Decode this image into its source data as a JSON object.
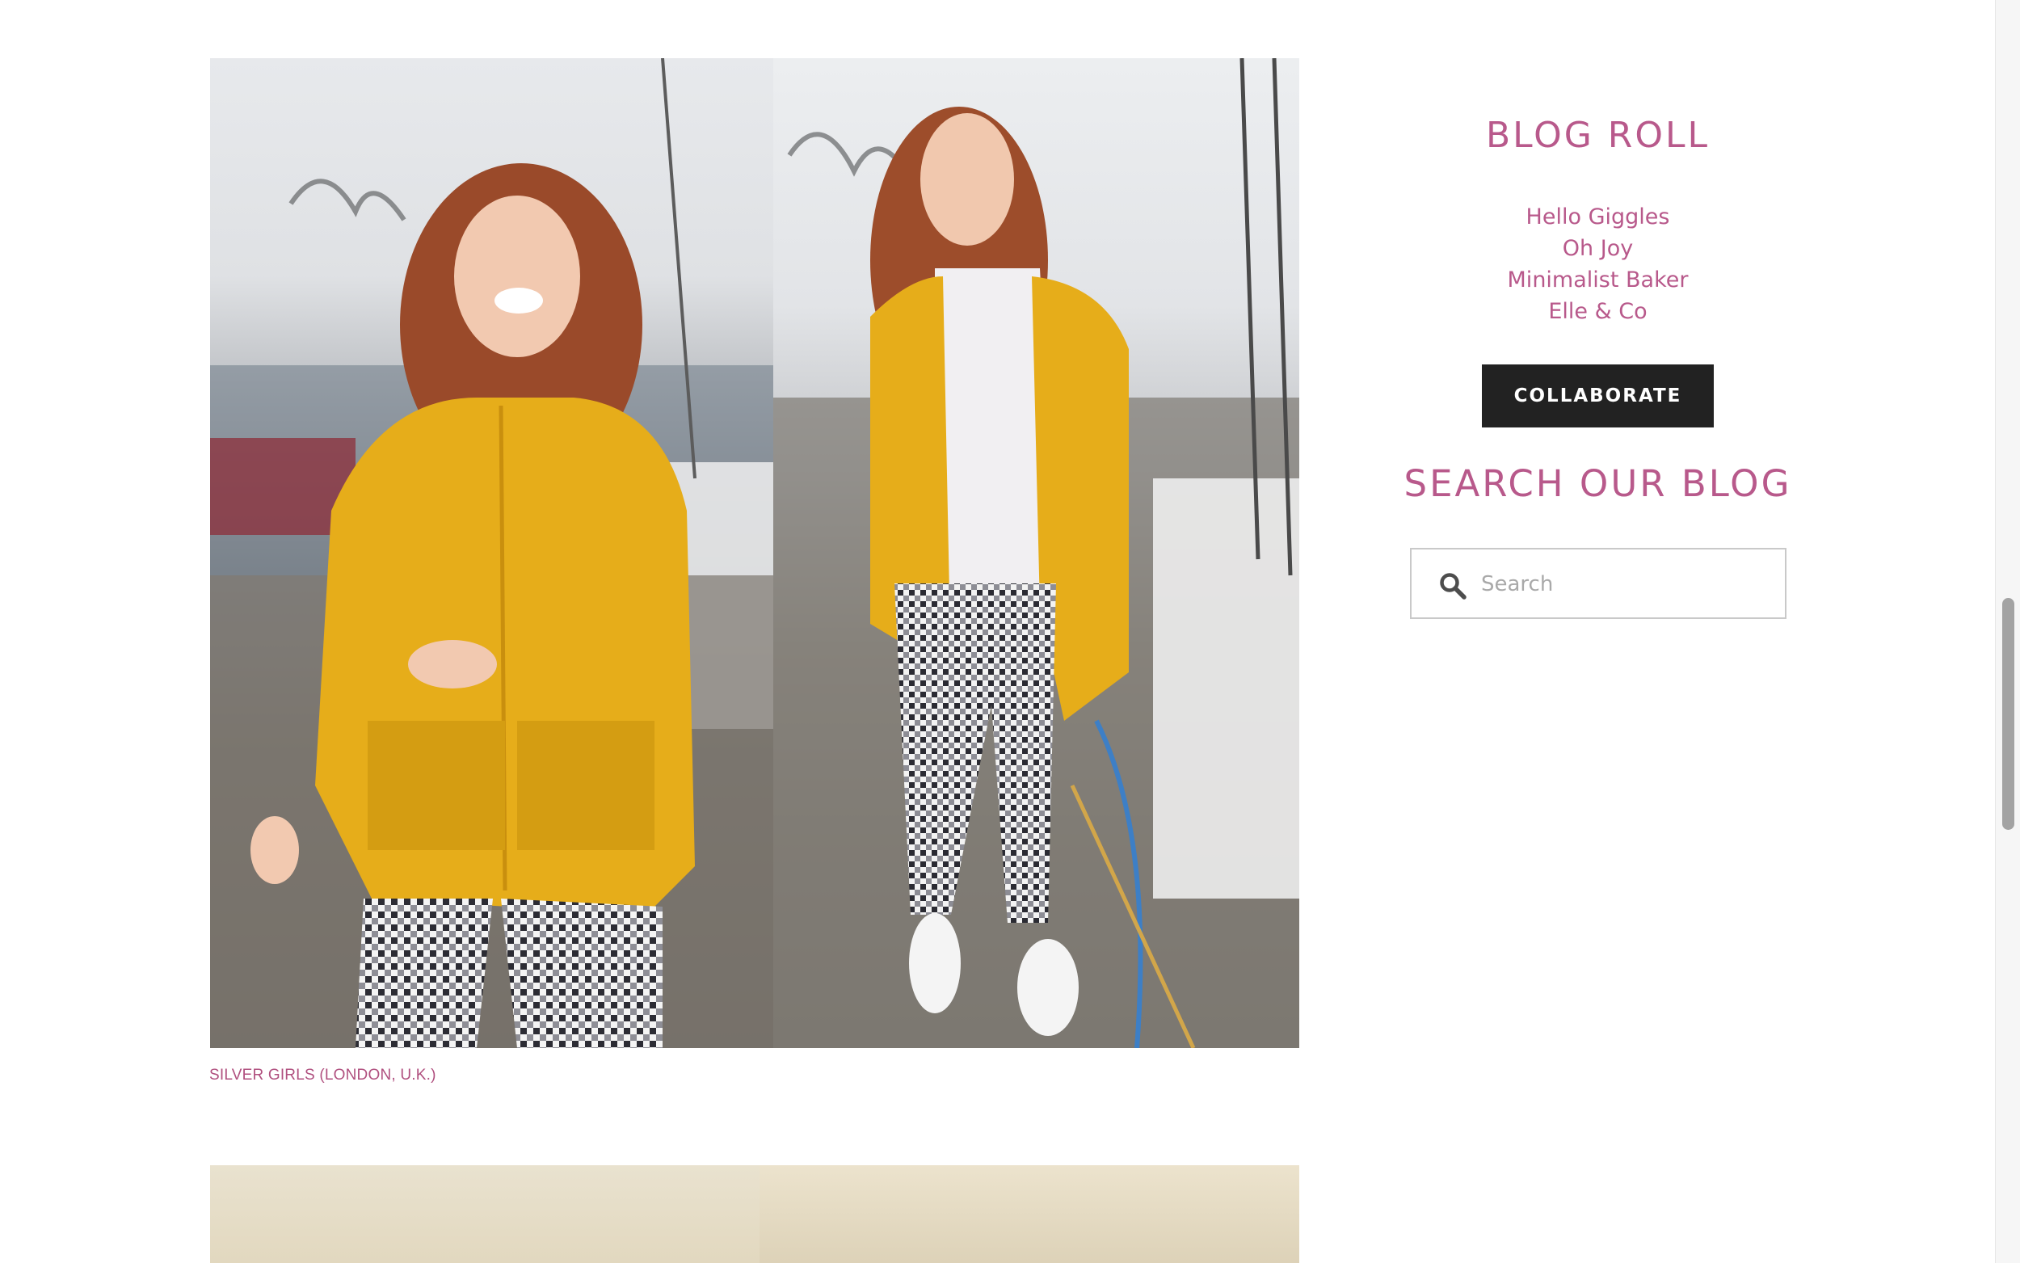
{
  "post": {
    "caption": "SILVER GIRLS (LONDON, U.K.)"
  },
  "sidebar": {
    "blog_roll": {
      "title": "BLOG ROLL",
      "links": [
        {
          "label": "Hello Giggles"
        },
        {
          "label": "Oh Joy"
        },
        {
          "label": "Minimalist Baker"
        },
        {
          "label": "Elle & Co"
        }
      ]
    },
    "collaborate_label": "COLLABORATE",
    "search": {
      "title": "SEARCH OUR BLOG",
      "placeholder": "Search"
    }
  },
  "colors": {
    "accent": "#b8598b",
    "button_bg": "#222222",
    "jacket": "#e6ad1a"
  }
}
